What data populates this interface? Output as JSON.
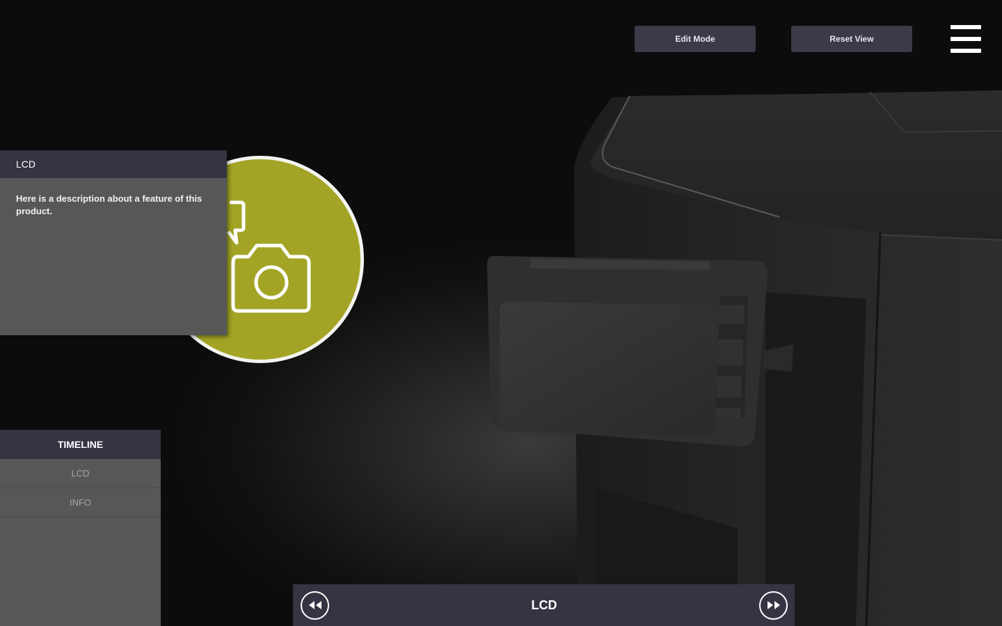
{
  "toolbar": {
    "edit_mode_label": "Edit Mode",
    "reset_view_label": "Reset View",
    "menu_icon": "hamburger-menu-icon"
  },
  "hotspot": {
    "icon": "camera-icon",
    "color": "#a3a425"
  },
  "info_panel": {
    "title": "LCD",
    "description": "Here is a description about a feature of this product."
  },
  "timeline": {
    "header": "TIMELINE",
    "items": [
      {
        "label": "LCD"
      },
      {
        "label": "INFO"
      }
    ]
  },
  "bottom_nav": {
    "prev_icon": "rewind-icon",
    "current_label": "LCD",
    "next_icon": "fast-forward-icon"
  },
  "colors": {
    "panel_header": "#363442",
    "panel_body": "#575757",
    "accent": "#a3a425"
  }
}
